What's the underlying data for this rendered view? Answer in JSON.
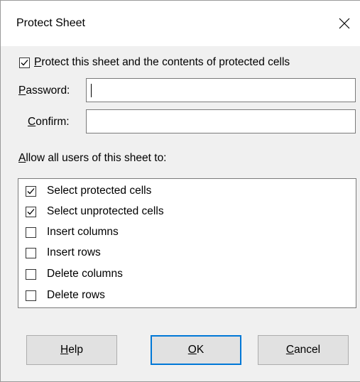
{
  "dialog": {
    "title": "Protect Sheet",
    "close_glyph": "close-icon"
  },
  "protect": {
    "checked": true,
    "label_pre": "",
    "label_mnemonic": "P",
    "label_post": "rotect this sheet and the contents of protected cells"
  },
  "password": {
    "label_mnemonic": "P",
    "label_post": "assword:",
    "value": ""
  },
  "confirm": {
    "label_mnemonic": "C",
    "label_post": "onfirm:",
    "value": ""
  },
  "allow": {
    "label_mnemonic": "A",
    "label_post": "llow all users of this sheet to:",
    "items": [
      {
        "label": "Select protected cells",
        "checked": true
      },
      {
        "label": "Select unprotected cells",
        "checked": true
      },
      {
        "label": "Insert columns",
        "checked": false
      },
      {
        "label": "Insert rows",
        "checked": false
      },
      {
        "label": "Delete columns",
        "checked": false
      },
      {
        "label": "Delete rows",
        "checked": false
      }
    ]
  },
  "buttons": {
    "help": {
      "mnemonic": "H",
      "rest": "elp"
    },
    "ok": {
      "mnemonic": "O",
      "rest": "K"
    },
    "cancel": {
      "mnemonic": "C",
      "rest": "ancel"
    }
  },
  "colors": {
    "default_button_border": "#0078d7",
    "dialog_bg": "#f0f0f0"
  }
}
